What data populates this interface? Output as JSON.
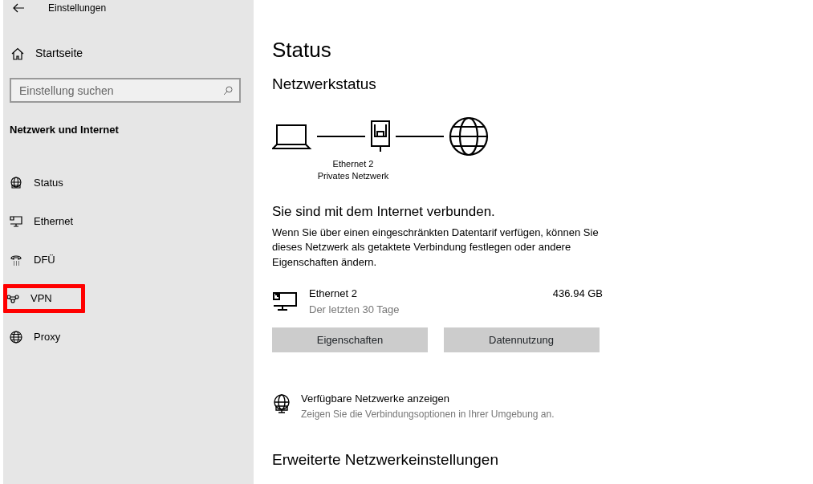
{
  "window": {
    "title": "Einstellungen"
  },
  "sidebar": {
    "home": "Startseite",
    "search": {
      "placeholder": "Einstellung suchen"
    },
    "section": "Netzwerk und Internet",
    "items": [
      {
        "label": "Status",
        "kind": "status",
        "highlighted": false
      },
      {
        "label": "Ethernet",
        "kind": "ethernet",
        "highlighted": false
      },
      {
        "label": "DFÜ",
        "kind": "dialup",
        "highlighted": false
      },
      {
        "label": "VPN",
        "kind": "vpn",
        "highlighted": true
      },
      {
        "label": "Proxy",
        "kind": "proxy",
        "highlighted": false
      }
    ]
  },
  "main": {
    "title": "Status",
    "network_status": {
      "heading": "Netzwerkstatus",
      "adapter": "Ethernet 2",
      "network": "Privates Netzwerk"
    },
    "connected": "Sie sind mit dem Internet verbunden.",
    "description": "Wenn Sie über einen eingeschränkten Datentarif verfügen, können Sie dieses Netzwerk als getaktete Verbindung festlegen oder andere Eigenschaften ändern.",
    "usage": {
      "name": "Ethernet 2",
      "period": "Der letzten 30 Tage",
      "amount": "436.94 GB"
    },
    "buttons": [
      "Eigenschaften",
      "Datennutzung"
    ],
    "available": {
      "title": "Verfügbare Netzwerke anzeigen",
      "subtitle": "Zeigen Sie die Verbindungsoptionen in Ihrer Umgebung an."
    },
    "advanced_heading": "Erweiterte Netzwerkeinstellungen"
  }
}
